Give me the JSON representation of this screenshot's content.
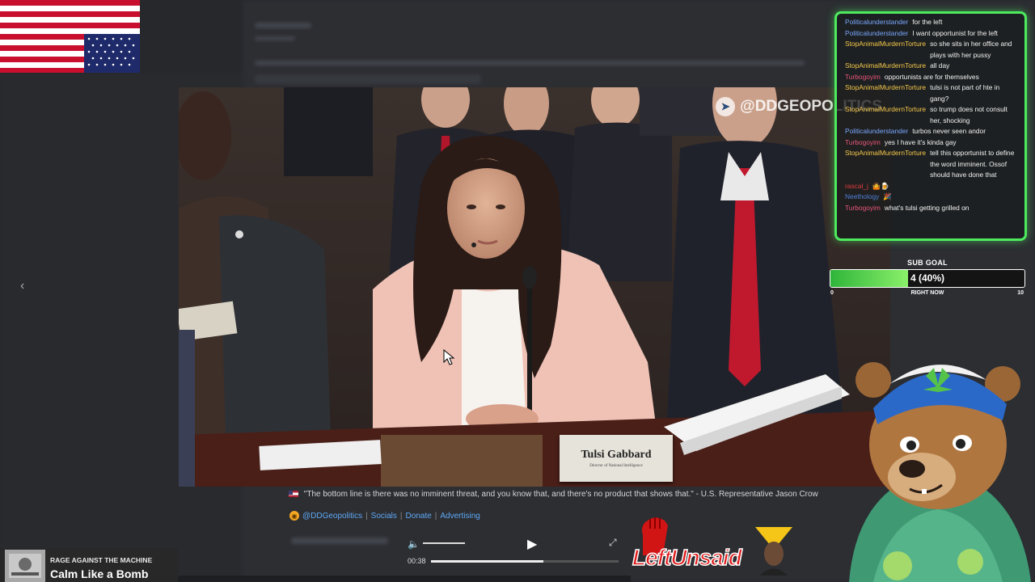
{
  "video": {
    "watermark": "@DDGEOPOLITICS",
    "nameplate_name": "Tulsi Gabbard",
    "nameplate_title": "Director of National Intelligence"
  },
  "caption": {
    "quote": "\"The bottom line is there was no imminent threat, and you know that, and there's no product that shows that.\" - U.S. Representative Jason Crow",
    "handle": "@DDGeopolitics",
    "links": [
      "Socials",
      "Donate",
      "Advertising"
    ]
  },
  "player": {
    "time": "00:38",
    "progress": 0.6,
    "volume_icon": "volume-icon",
    "play_icon": "play-icon",
    "fullscreen_icon": "fullscreen-icon"
  },
  "chat": {
    "messages": [
      {
        "user": "Politicalunderstander",
        "color": "#7aa8ff",
        "text": "for the left"
      },
      {
        "user": "Politicalunderstander",
        "color": "#7aa8ff",
        "text": "I want opportunist for the left"
      },
      {
        "user": "StopAnimalMurdernTorture",
        "color": "#f5c84a",
        "text": "so she sits in her office and plays with her pussy"
      },
      {
        "user": "StopAnimalMurdernTorture",
        "color": "#f5c84a",
        "text": "all day"
      },
      {
        "user": "Turbogoyim",
        "color": "#e8567a",
        "text": "opportunists are for themselves"
      },
      {
        "user": "StopAnimalMurdernTorture",
        "color": "#f5c84a",
        "text": "tulsi is not part of hte in gang?"
      },
      {
        "user": "StopAnimalMurdernTorture",
        "color": "#f5c84a",
        "text": "so trump does not consult her, shocking"
      },
      {
        "user": "Politicalunderstander",
        "color": "#7aa8ff",
        "text": "turbos never seen andor"
      },
      {
        "user": "Turbogoyim",
        "color": "#e8567a",
        "text": "yes I have it's kinda gay"
      },
      {
        "user": "StopAnimalMurdernTorture",
        "color": "#f5c84a",
        "text": "tell this opportunist to define the word imminent. Ossof should have done that"
      },
      {
        "user": "rascal_j",
        "color": "#e23b3b",
        "text": "🤷🍺"
      },
      {
        "user": "Neethology",
        "color": "#4d7fd6",
        "text": "🎉"
      },
      {
        "user": "Turbogoyim",
        "color": "#e8567a",
        "text": "what's tulsi getting grilled on"
      }
    ]
  },
  "sub_goal": {
    "title": "SUB GOAL",
    "label": "4 (40%)",
    "current": 4,
    "goal": 10,
    "fraction": 0.4,
    "min_label": "0",
    "max_label": "10",
    "now_label": "RIGHT NOW"
  },
  "now_playing": {
    "artist": "RAGE AGAINST THE MACHINE",
    "song": "Calm Like a Bomb"
  },
  "logo": {
    "text": "LeftUnsaid"
  },
  "colors": {
    "chat_border": "#4dea5e",
    "logo_red": "#e11d1d",
    "link_blue": "#5fa8f5"
  }
}
